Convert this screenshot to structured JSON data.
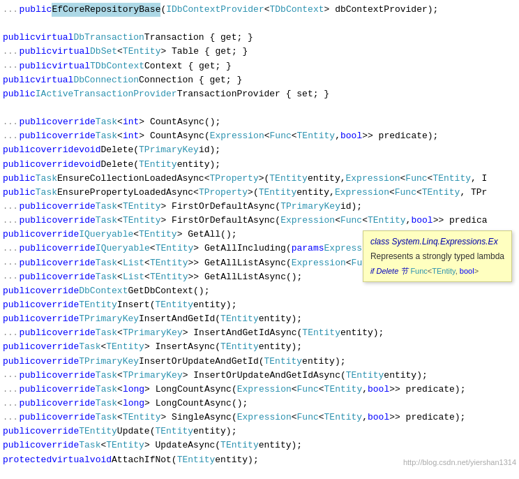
{
  "colors": {
    "keyword": "#0000ff",
    "type": "#2b91af",
    "text": "#000000",
    "dots": "#888888",
    "highlight": "#add8e6",
    "tooltip_bg": "#ffffc0",
    "watermark": "#aaaaaa"
  },
  "tooltip": {
    "line1": "class System.Linq.Expressions.Ex",
    "line2": "Represents a strongly typed lambda",
    "icon": "⬛"
  },
  "watermark": "http://blog.csdn.net/yiershan1314",
  "lines": [
    {
      "id": 1,
      "has_dots": true,
      "content": "...public EfCoreRepositoryBase(IDbContextProvider<TDbContext> dbContextProvider);"
    },
    {
      "id": 2,
      "has_dots": false,
      "content": ""
    },
    {
      "id": 3,
      "has_dots": false,
      "content": "public virtual DbTransaction Transaction { get; }"
    },
    {
      "id": 4,
      "has_dots": true,
      "content": "...public virtual DbSet<TEntity> Table { get; }"
    },
    {
      "id": 5,
      "has_dots": true,
      "content": "...public virtual TDbContext Context { get; }"
    },
    {
      "id": 6,
      "has_dots": false,
      "content": "public virtual DbConnection Connection { get; }"
    },
    {
      "id": 7,
      "has_dots": false,
      "content": "public IActiveTransactionProvider TransactionProvider { set; }"
    },
    {
      "id": 8,
      "has_dots": false,
      "content": ""
    },
    {
      "id": 9,
      "has_dots": true,
      "content": "...public override Task<int> CountAsync();"
    },
    {
      "id": 10,
      "has_dots": true,
      "content": "...public override Task<int> CountAsync(Expression<Func<TEntity, bool>> predicate);"
    },
    {
      "id": 11,
      "has_dots": false,
      "content": "public override void Delete(TPrimaryKey id);"
    },
    {
      "id": 12,
      "has_dots": false,
      "content": "public override void Delete(TEntity entity);"
    },
    {
      "id": 13,
      "has_dots": false,
      "content": "public Task EnsureCollectionLoadedAsync<TProperty>(TEntity entity, Expression<Func<TEntity, I"
    },
    {
      "id": 14,
      "has_dots": false,
      "content": "public Task EnsurePropertyLoadedAsync<TProperty>(TEntity entity, Expression<Func<TEntity, TPr"
    },
    {
      "id": 15,
      "has_dots": true,
      "content": "...public override Task<TEntity> FirstOrDefaultAsync(TPrimaryKey id);"
    },
    {
      "id": 16,
      "has_dots": true,
      "content": "...public override Task<TEntity> FirstOrDefaultAsync(Expression<Func<TEntity, bool>> predica"
    },
    {
      "id": 17,
      "has_dots": false,
      "content": "public override IQueryable<TEntity> GetAll();"
    },
    {
      "id": 18,
      "has_dots": true,
      "content": "...public override IQueryable<TEntity> GetAllIncluding(params Expression<Func<TEntity, object>>["
    },
    {
      "id": 19,
      "has_dots": true,
      "content": "...public override Task<List<TEntity>> GetAllListAsync(Expression<Func<TEntity, bool>> predi"
    },
    {
      "id": 20,
      "has_dots": true,
      "content": "...public override Task<List<TEntity>> GetAllListAsync();"
    },
    {
      "id": 21,
      "has_dots": false,
      "content": "public override DbContext GetDbContext();"
    },
    {
      "id": 22,
      "has_dots": false,
      "content": "public override TEntity Insert(TEntity entity);"
    },
    {
      "id": 23,
      "has_dots": false,
      "content": "public override TPrimaryKey InsertAndGetId(TEntity entity);"
    },
    {
      "id": 24,
      "has_dots": true,
      "content": "...public override Task<TPrimaryKey> InsertAndGetIdAsync(TEntity entity);"
    },
    {
      "id": 25,
      "has_dots": false,
      "content": "public override Task<TEntity> InsertAsync(TEntity entity);"
    },
    {
      "id": 26,
      "has_dots": false,
      "content": "public override TPrimaryKey InsertOrUpdateAndGetId(TEntity entity);"
    },
    {
      "id": 27,
      "has_dots": true,
      "content": "...public override Task<TPrimaryKey> InsertOrUpdateAndGetIdAsync(TEntity entity);"
    },
    {
      "id": 28,
      "has_dots": true,
      "content": "...public override Task<long> LongCountAsync(Expression<Func<TEntity, bool>> predicate);"
    },
    {
      "id": 29,
      "has_dots": true,
      "content": "...public override Task<long> LongCountAsync();"
    },
    {
      "id": 30,
      "has_dots": true,
      "content": "...public override Task<TEntity> SingleAsync(Expression<Func<TEntity, bool>> predicate);"
    },
    {
      "id": 31,
      "has_dots": false,
      "content": "public override TEntity Update(TEntity entity);"
    },
    {
      "id": 32,
      "has_dots": false,
      "content": "public override Task<TEntity> UpdateAsync(TEntity entity);"
    },
    {
      "id": 33,
      "has_dots": false,
      "content": "protected virtual void AttachIfNot(TEntity entity);"
    }
  ]
}
